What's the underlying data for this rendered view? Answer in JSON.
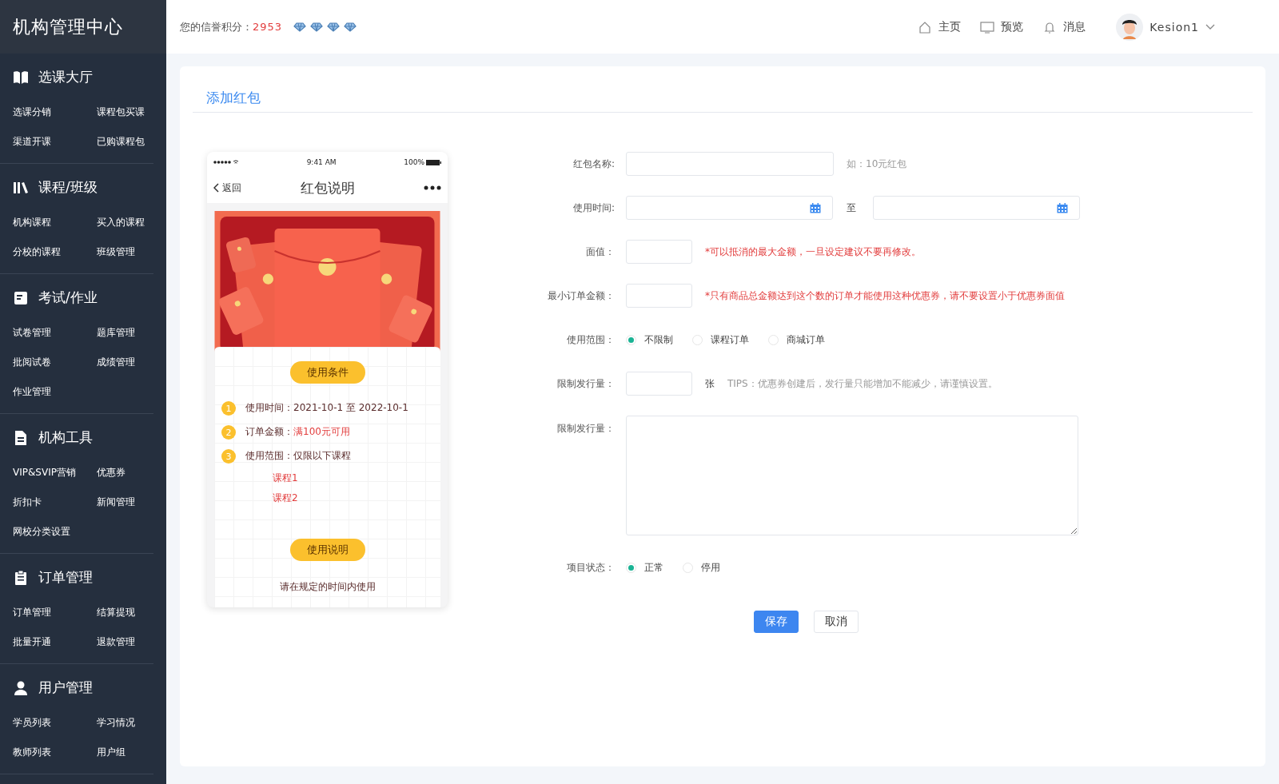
{
  "sidebar": {
    "title": "机构管理中心",
    "sections": [
      {
        "title": "选课大厅",
        "items": [
          "选课分销",
          "课程包买课",
          "渠道开课",
          "已购课程包"
        ]
      },
      {
        "title": "课程/班级",
        "items": [
          "机构课程",
          "买入的课程",
          "分校的课程",
          "班级管理"
        ]
      },
      {
        "title": "考试/作业",
        "items": [
          "试卷管理",
          "题库管理",
          "批阅试卷",
          "成绩管理",
          "作业管理"
        ]
      },
      {
        "title": "机构工具",
        "items": [
          "VIP&SVIP营销",
          "优惠券",
          "折扣卡",
          "新闻管理",
          "网校分类设置"
        ]
      },
      {
        "title": "订单管理",
        "items": [
          "订单管理",
          "结算提现",
          "批量开通",
          "退款管理"
        ]
      },
      {
        "title": "用户管理",
        "items": [
          "学员列表",
          "学习情况",
          "教师列表",
          "用户组"
        ]
      }
    ]
  },
  "header": {
    "credit_label": "您的信誉积分：",
    "credit_score": "2953",
    "stars": 4,
    "nav": [
      {
        "label": "主页"
      },
      {
        "label": "预览"
      },
      {
        "label": "消息"
      }
    ],
    "user": {
      "name": "Kesion1"
    }
  },
  "page_title": "添加红包",
  "phone": {
    "time": "9:41 AM",
    "battery": "100%",
    "back": "返回",
    "title": "红包说明",
    "conditions_button": "使用条件",
    "conditions": [
      {
        "number": "1",
        "label": "使用时间：",
        "value": "2021-10-1 至 2022-10-1",
        "highlight": false
      },
      {
        "number": "2",
        "label": "订单金额：",
        "value": "满100元可用",
        "highlight": true
      },
      {
        "number": "3",
        "label": "使用范围：",
        "value": "仅限以下课程",
        "highlight": false,
        "sub": [
          "课程1",
          "课程2"
        ]
      }
    ],
    "notes_button": "使用说明",
    "footer": "请在规定的时间内使用"
  },
  "form": {
    "rows": [
      {
        "kind": "text",
        "label": "红包名称:",
        "hint": "如：10元红包"
      },
      {
        "kind": "daterange",
        "label": "使用时间:",
        "separator": "至"
      },
      {
        "kind": "number",
        "label": "面值：",
        "note": "*可以抵消的最大金额，一旦设定建议不要再修改。"
      },
      {
        "kind": "number",
        "label": "最小订单金额：",
        "note": "*只有商品总金额达到这个数的订单才能使用这种优惠券，请不要设置小于优惠券面值"
      },
      {
        "kind": "radio",
        "label": "使用范围：",
        "options": [
          {
            "label": "不限制",
            "selected": true
          },
          {
            "label": "课程订单",
            "selected": false
          },
          {
            "label": "商城订单",
            "selected": false
          }
        ]
      },
      {
        "kind": "number",
        "label": "限制发行量：",
        "unit": "张",
        "hint": "TIPS：优惠券创建后，发行量只能增加不能减少，请谨慎设置。"
      },
      {
        "kind": "textarea",
        "label": "限制发行量："
      },
      {
        "kind": "radio",
        "label": "项目状态：",
        "options": [
          {
            "label": "正常",
            "selected": true
          },
          {
            "label": "停用",
            "selected": false
          }
        ]
      }
    ],
    "buttons": [
      {
        "label": "保存",
        "kind": "primary"
      },
      {
        "label": "取消",
        "kind": "default"
      }
    ]
  }
}
